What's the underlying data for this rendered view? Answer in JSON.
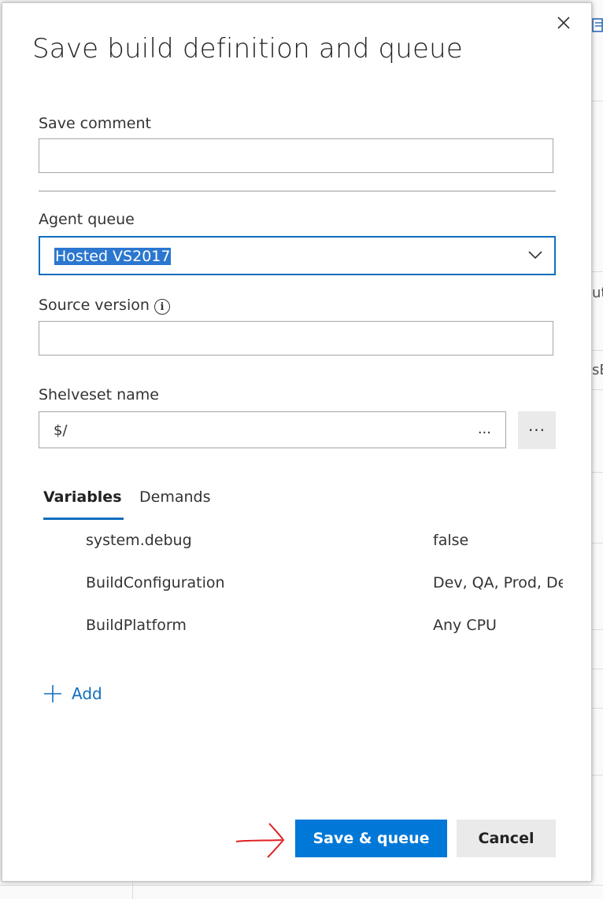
{
  "dialog": {
    "title": "Save build definition and queue",
    "close_icon": "close-icon"
  },
  "save_comment": {
    "label": "Save comment",
    "value": "",
    "placeholder": ""
  },
  "agent_queue": {
    "label": "Agent queue",
    "selected": "Hosted VS2017",
    "icon": "chevron-down-icon"
  },
  "source_version": {
    "label": "Source version",
    "info_icon": "info-icon",
    "value": ""
  },
  "shelveset": {
    "label": "Shelveset name",
    "value": "$/",
    "ellipsis": "...",
    "more_label": "···"
  },
  "tabs": [
    {
      "label": "Variables",
      "active": true
    },
    {
      "label": "Demands",
      "active": false
    }
  ],
  "variables": [
    {
      "name": "system.debug",
      "value": "false"
    },
    {
      "name": "BuildConfiguration",
      "value": "Dev, QA, Prod, De"
    },
    {
      "name": "BuildPlatform",
      "value": "Any CPU"
    }
  ],
  "add_link": {
    "label": "Add",
    "icon": "plus-icon"
  },
  "buttons": {
    "primary": "Save & queue",
    "secondary": "Cancel"
  },
  "background": {
    "fragment_1": "ut",
    "fragment_2": "sE"
  },
  "colors": {
    "accent": "#0078d7",
    "annotation": "#e02020"
  }
}
